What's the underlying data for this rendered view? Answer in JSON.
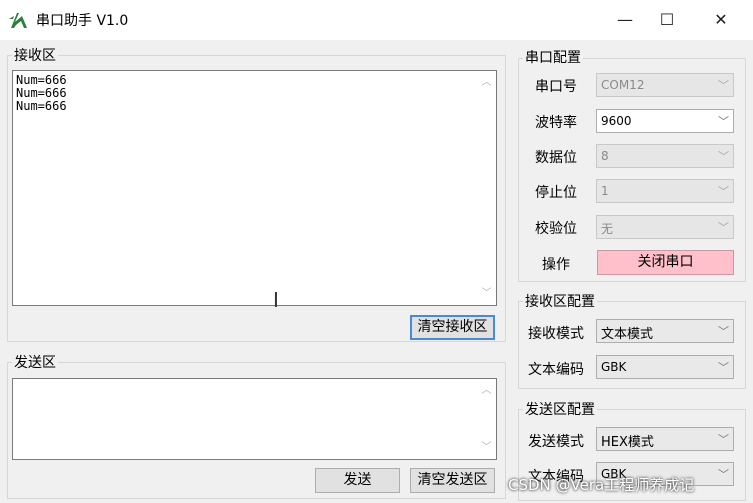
{
  "window": {
    "title": "串口助手 V1.0",
    "minimize_glyph": "—",
    "maximize_glyph": "☐",
    "close_glyph": "✕",
    "icon": "app-logo-icon"
  },
  "receive": {
    "group_label": "接收区",
    "lines": [
      "Num=666",
      "Num=666",
      "Num=666"
    ],
    "clear_button": "清空接收区"
  },
  "send": {
    "group_label": "发送区",
    "text": "",
    "send_button": "发送",
    "clear_button": "清空发送区"
  },
  "serial_config": {
    "group_label": "串口配置",
    "port_label": "串口号",
    "port_value": "COM12",
    "baud_label": "波特率",
    "baud_value": "9600",
    "databits_label": "数据位",
    "databits_value": "8",
    "stopbits_label": "停止位",
    "stopbits_value": "1",
    "parity_label": "校验位",
    "parity_value": "无",
    "action_label": "操作",
    "action_button": "关闭串口",
    "action_color": "#ffc0cb"
  },
  "recv_config": {
    "group_label": "接收区配置",
    "mode_label": "接收模式",
    "mode_value": "文本模式",
    "encoding_label": "文本编码",
    "encoding_value": "GBK"
  },
  "send_config": {
    "group_label": "发送区配置",
    "mode_label": "发送模式",
    "mode_value": "HEX模式",
    "encoding_label": "文本编码",
    "encoding_value": "GBK"
  },
  "watermark": {
    "bottom": "CSDN @Vera工程师养成记"
  }
}
